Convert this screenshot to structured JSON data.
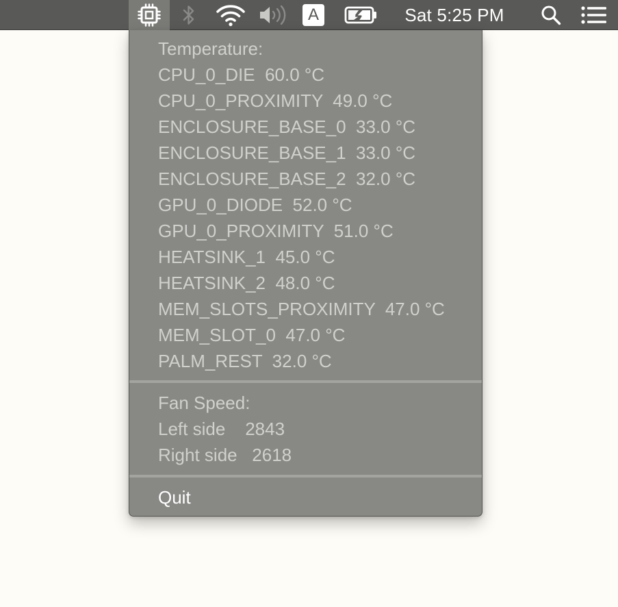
{
  "menubar": {
    "clock": "Sat 5:25 PM",
    "input_source": "A",
    "icons": [
      "cpu-icon",
      "bluetooth-icon",
      "wifi-icon",
      "volume-icon",
      "input-source-icon",
      "battery-charging-icon",
      "spotlight-search-icon",
      "notification-center-icon"
    ]
  },
  "menu": {
    "temperature_header": "Temperature:",
    "temperatures": [
      {
        "name": "CPU_0_DIE",
        "value": "60.0 °C"
      },
      {
        "name": "CPU_0_PROXIMITY",
        "value": "49.0 °C"
      },
      {
        "name": "ENCLOSURE_BASE_0",
        "value": "33.0 °C"
      },
      {
        "name": "ENCLOSURE_BASE_1",
        "value": "33.0 °C"
      },
      {
        "name": "ENCLOSURE_BASE_2",
        "value": "32.0 °C"
      },
      {
        "name": "GPU_0_DIODE",
        "value": "52.0 °C"
      },
      {
        "name": "GPU_0_PROXIMITY",
        "value": "51.0 °C"
      },
      {
        "name": "HEATSINK_1",
        "value": "45.0 °C"
      },
      {
        "name": "HEATSINK_2",
        "value": "48.0 °C"
      },
      {
        "name": "MEM_SLOTS_PROXIMITY",
        "value": "47.0 °C"
      },
      {
        "name": "MEM_SLOT_0",
        "value": "47.0 °C"
      },
      {
        "name": "PALM_REST",
        "value": "32.0 °C"
      }
    ],
    "fan_header": "Fan Speed:",
    "fans": [
      {
        "name": "Left side",
        "value": "2843"
      },
      {
        "name": "Right side",
        "value": "2618"
      }
    ],
    "quit_label": "Quit"
  },
  "colors": {
    "menubar_bg": "#595957",
    "menu_bg": "#888885",
    "menu_text_disabled": "#d0d0cc",
    "menu_text_enabled": "#ffffff",
    "desktop_bg": "#fefcf6"
  }
}
